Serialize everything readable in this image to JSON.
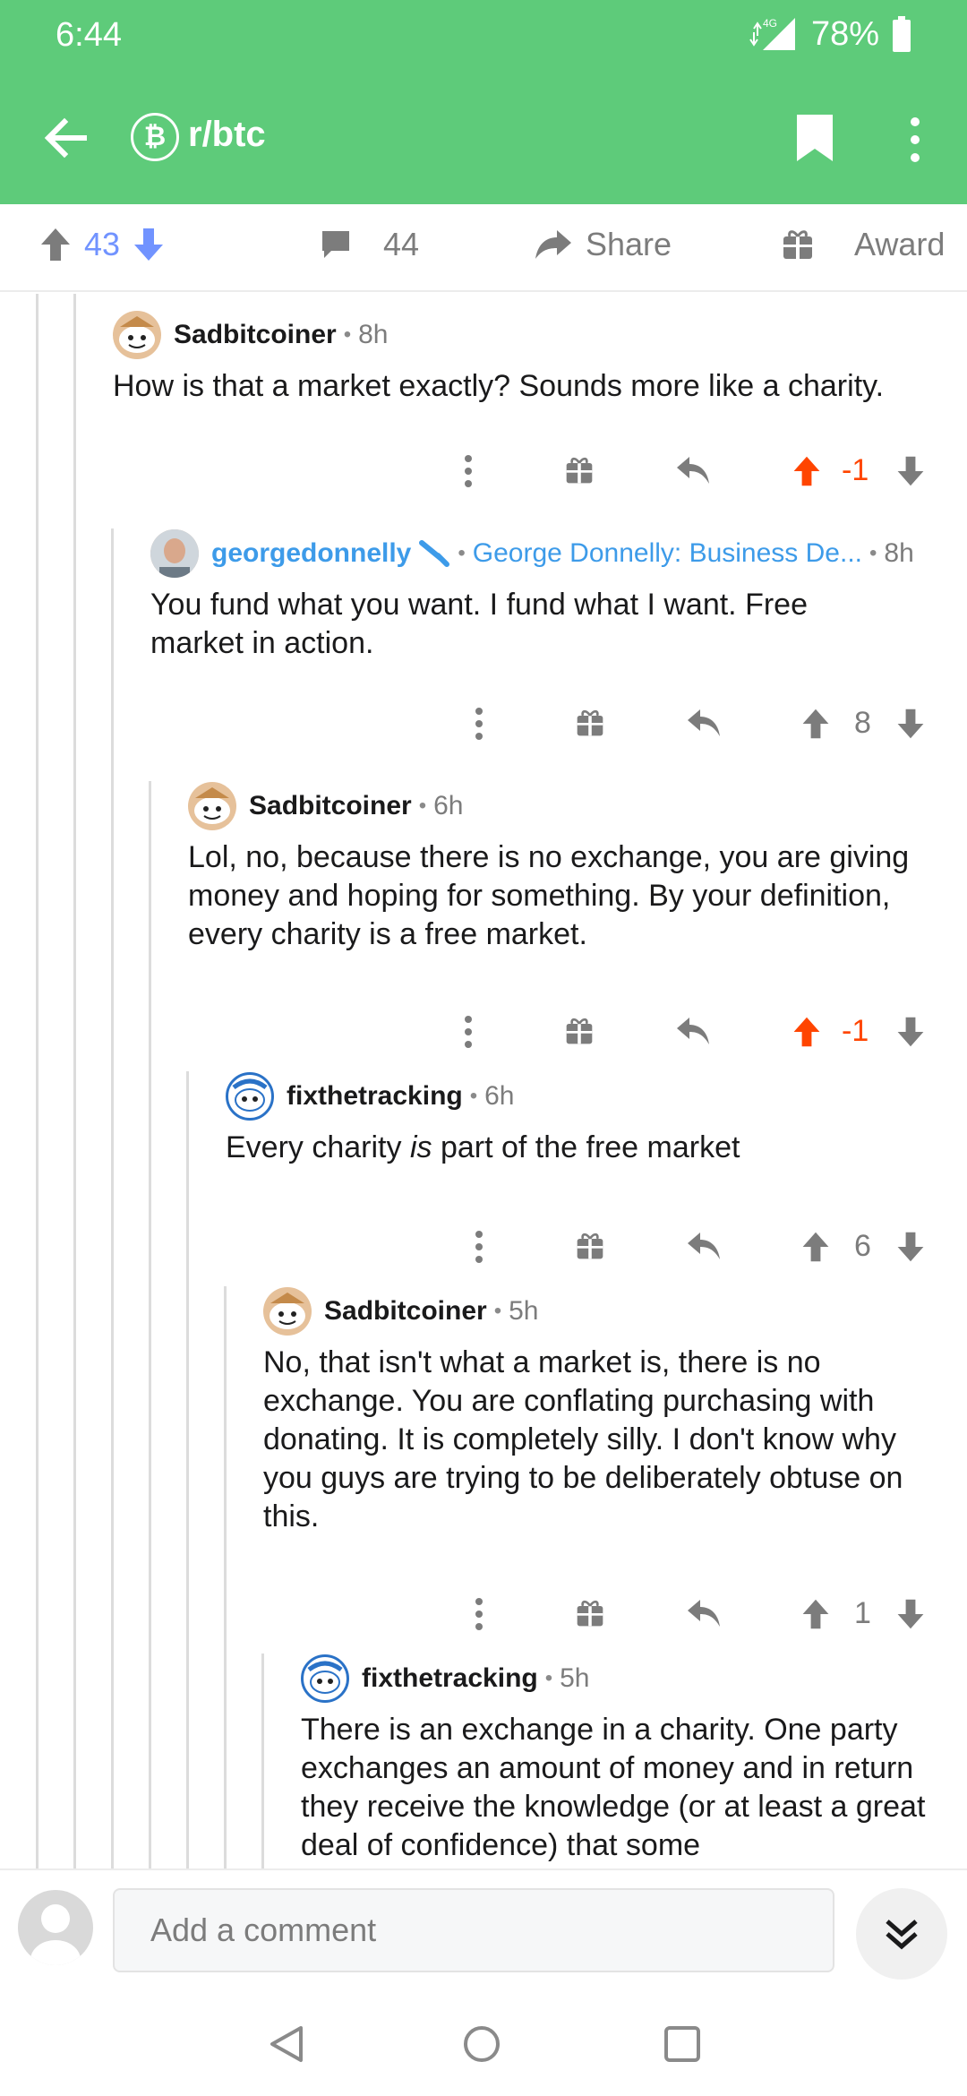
{
  "status": {
    "time": "6:44",
    "network": "4G",
    "battery": "78%"
  },
  "header": {
    "subreddit": "r/btc",
    "sub_icon_glyph": "₿"
  },
  "post_actions": {
    "votes": "43",
    "comments": "44",
    "share": "Share",
    "award": "Award"
  },
  "comments": [
    {
      "author": "Sadbitcoiner",
      "age": "8h",
      "body": "How is that a market exactly? Sounds more like a charity.",
      "score": "-1",
      "vote_state": "downvoted"
    },
    {
      "author": "georgedonnelly",
      "flair": "George Donnelly: Business De...",
      "age": "8h",
      "body": "You fund what you want. I fund what I want. Free market in action.",
      "score": "8"
    },
    {
      "author": "Sadbitcoiner",
      "age": "6h",
      "body": "Lol, no, because there is no exchange, you are giving money and hoping for something. By your definition, every charity is a free market.",
      "score": "-1",
      "vote_state": "downvoted"
    },
    {
      "author": "fixthetracking",
      "age": "6h",
      "body_pre": "Every charity ",
      "body_em": "is",
      "body_post": " part of the free market",
      "score": "6"
    },
    {
      "author": "Sadbitcoiner",
      "age": "5h",
      "body": "No, that isn't what a market is, there is no exchange. You are conflating purchasing with donating. It is completely silly. I don't know why you guys are trying to be deliberately obtuse on this.",
      "score": "1"
    },
    {
      "author": "fixthetracking",
      "age": "5h",
      "body": "There is an exchange in a charity. One party exchanges an amount of money and in return they receive the knowledge (or at least a great deal of confidence) that some"
    }
  ],
  "composer": {
    "placeholder": "Add a comment"
  },
  "colors": {
    "appbar": "#5ecb7a",
    "upvote": "#7193ff",
    "downvoted": "#ff4500",
    "op": "#3d9be9"
  }
}
